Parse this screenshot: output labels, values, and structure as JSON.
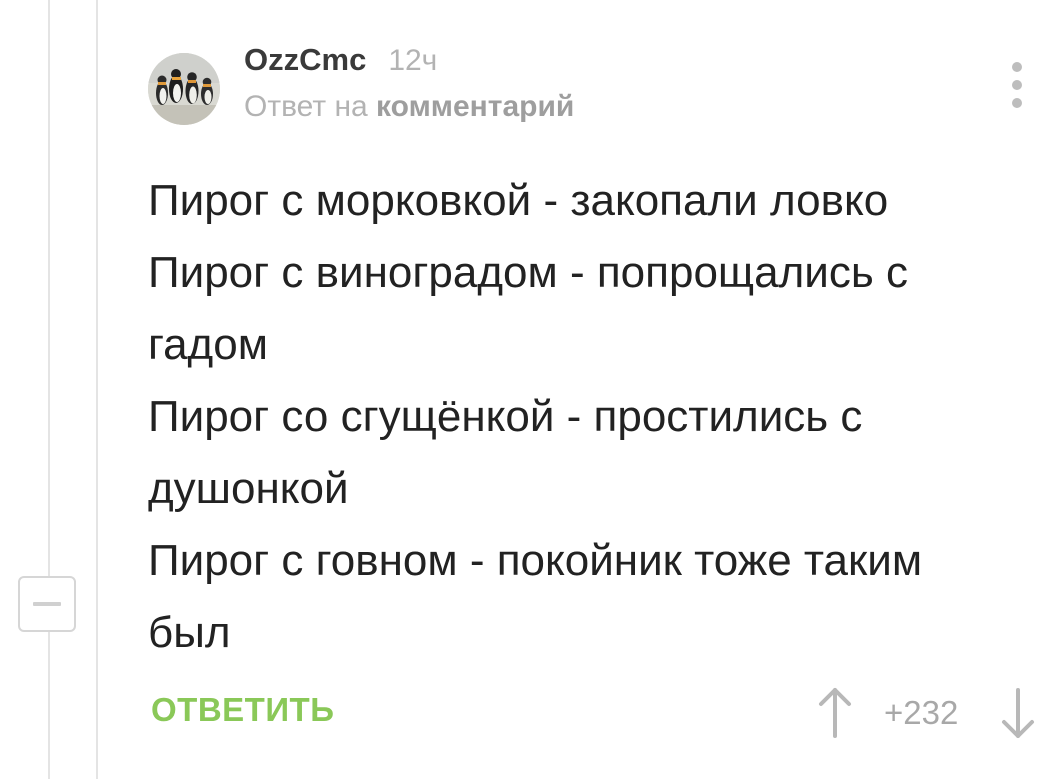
{
  "comment": {
    "author": "OzzCmc",
    "time": "12ч",
    "reply_prefix": "Ответ на",
    "reply_target": "комментарий",
    "body_lines": [
      "Пирог с морковкой - закопали ловко",
      "Пирог с виноградом - попрощались с",
      "гадом",
      "Пирог со сгущёнкой - простились с",
      "душонкой",
      "Пирог с говном - покойник тоже таким",
      "был"
    ],
    "reply_label": "ОТВЕТИТЬ",
    "rating": "+232"
  },
  "icons": {
    "vote_up": "arrow-up-icon",
    "vote_down": "arrow-down-icon",
    "menu": "more-vertical-icon",
    "collapse": "minus-icon"
  },
  "colors": {
    "accent_green": "#8ac858",
    "muted_gray": "#b3b3b3",
    "text": "#222222"
  }
}
